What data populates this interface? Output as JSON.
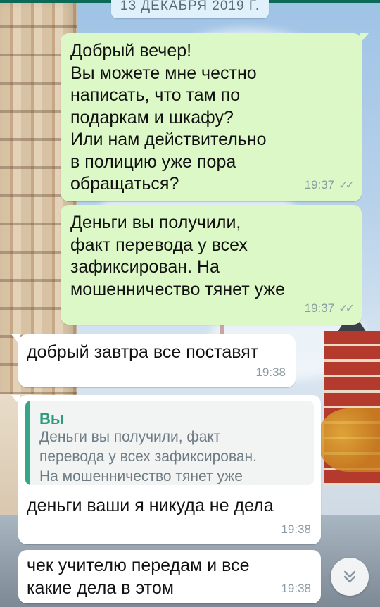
{
  "date_chip": "13 ДЕКАБРЯ 2019 Г.",
  "messages": [
    {
      "text": "Добрый вечер!\nВы можете мне честно\nнаписать, что там по\nподаркам и шкафу?\nИли нам действительно\nв полицию уже пора\nобращаться?",
      "time": "19:37",
      "status": "✓✓",
      "direction": "outgoing"
    },
    {
      "text": "Деньги вы получили,\nфакт перевода у всех\nзафиксирован. На\nмошенничество тянет уже",
      "time": "19:37",
      "status": "✓✓",
      "direction": "outgoing"
    },
    {
      "text": "добрый завтра все поставят",
      "time": "19:38",
      "direction": "incoming"
    },
    {
      "quote_author": "Вы",
      "quote_text": "Деньги вы получили, факт\nперевода у всех зафиксирован.\nНа мошенничество тянет уже",
      "text": "деньги ваши я никуда не дела",
      "time": "19:38",
      "direction": "incoming"
    },
    {
      "text": "чек учителю передам и все\nкакие дела в этом",
      "time": "19:38",
      "direction": "incoming"
    }
  ],
  "icons": {
    "scroll_down": "double-chevron-down-icon",
    "read_receipt": "double-check-icon"
  },
  "colors": {
    "outgoing_bubble": "#dcf8c6",
    "incoming_bubble": "#ffffff",
    "quote_accent": "#35a687",
    "date_chip": "#e1f1fb"
  }
}
